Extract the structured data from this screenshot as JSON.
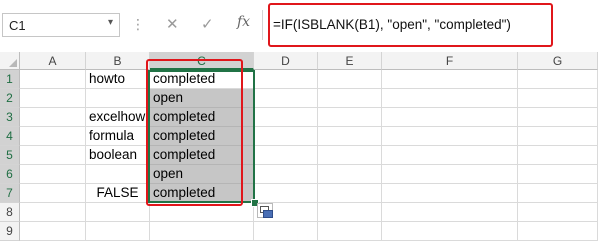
{
  "formula_bar": {
    "name_box": "C1",
    "name_box_arrow": "▾",
    "separator": "⋮",
    "cancel_icon": "✕",
    "enter_icon": "✓",
    "function_icon": "fx",
    "formula": "=IF(ISBLANK(B1), \"open\", \"completed\")"
  },
  "columns": [
    "A",
    "B",
    "C",
    "D",
    "E",
    "F",
    "G"
  ],
  "selected_column": "C",
  "rows": [
    "1",
    "2",
    "3",
    "4",
    "5",
    "6",
    "7",
    "8",
    "9"
  ],
  "selected_rows": [
    "1",
    "2",
    "3",
    "4",
    "5",
    "6",
    "7"
  ],
  "cells": {
    "B1": "howto",
    "B3": "excelhow",
    "B4": "formula",
    "B5": "boolean",
    "B7": "FALSE",
    "C1": "completed",
    "C2": "open",
    "C3": "completed",
    "C4": "completed",
    "C5": "completed",
    "C6": "open",
    "C7": "completed"
  },
  "colors": {
    "excel_green": "#217346",
    "highlight_red": "#e0161b",
    "selection_gray": "#c6c6c6"
  }
}
